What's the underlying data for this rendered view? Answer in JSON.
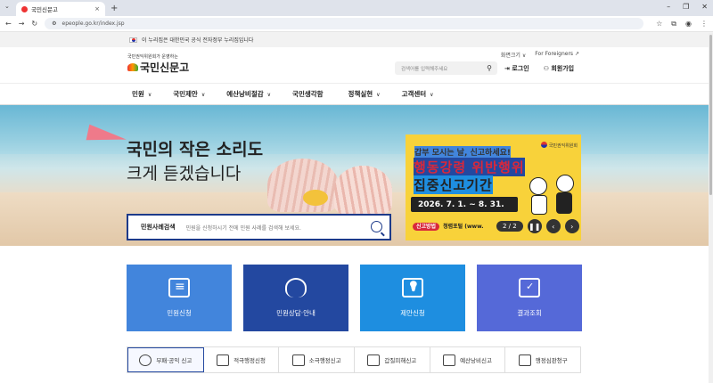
{
  "browser": {
    "tab_title": "국민신문고",
    "url": "epeople.go.kr/index.jsp"
  },
  "gov_notice": "이 누리집은 대한민국 공식 전자정부 누리집입니다",
  "header": {
    "logo_sub": "국민권익위원회가 운영하는",
    "logo_main": "국민신문고",
    "font_size_link": "화면크기",
    "foreigners_link": "For Foreigners",
    "search_placeholder": "검색어를 입력해주세요",
    "login": "로그인",
    "signup": "회원가입"
  },
  "nav": [
    {
      "label": "민원",
      "chev": "∨"
    },
    {
      "label": "국민제안",
      "chev": "∨"
    },
    {
      "label": "예산낭비절감",
      "chev": "∨"
    },
    {
      "label": "국민생각함",
      "chev": ""
    },
    {
      "label": "정책실현",
      "chev": "∨"
    },
    {
      "label": "고객센터",
      "chev": "∨"
    }
  ],
  "hero": {
    "line1": "국민의 작은 소리도",
    "line2": "크게 듣겠습니다",
    "case_search_label": "민원사례검색",
    "case_search_placeholder": "민원을 신청하시기 전에 민원 사례를 검색해 보세요."
  },
  "banner": {
    "org": "국민권익위원회",
    "line1": "갑부 모시는 날, 신고하세요!",
    "line2": "행동강령 위반행위",
    "line3": "집중신고기간",
    "date": "2026. 7. 1. ~ 8. 31.",
    "method_label": "신고방법",
    "method_text": "청렴포털 (www.",
    "page": "2 / 2"
  },
  "tiles": [
    {
      "label": "민원신청"
    },
    {
      "label": "민원상담·안내"
    },
    {
      "label": "제안신청"
    },
    {
      "label": "결과조회"
    }
  ],
  "reports": [
    {
      "label": "부패·공익 신고"
    },
    {
      "label": "적극행정신청"
    },
    {
      "label": "소극행정신고"
    },
    {
      "label": "갑질피해신고"
    },
    {
      "label": "예산낭비신고"
    },
    {
      "label": "행정심판청구"
    }
  ]
}
